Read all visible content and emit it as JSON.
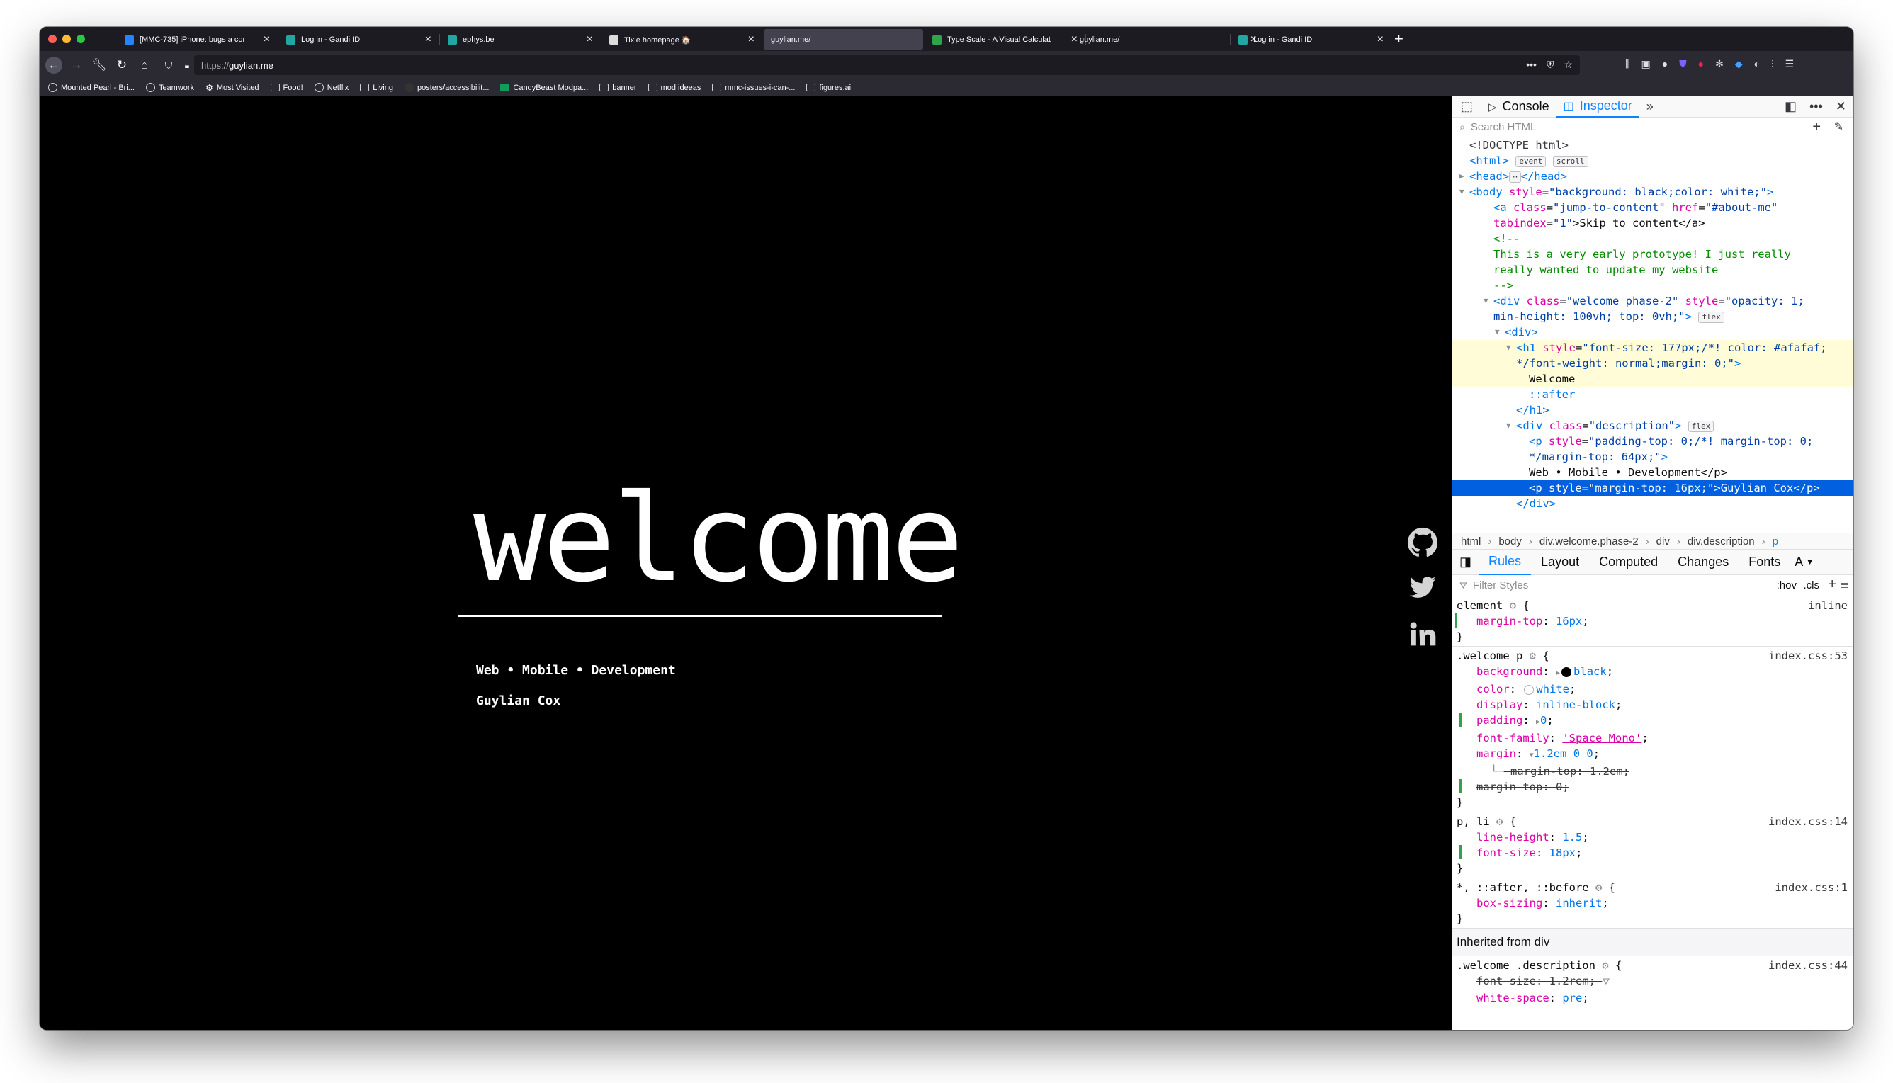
{
  "browser": {
    "tabs": [
      {
        "title": "[MMC-735] iPhone: bugs a cor",
        "active": false
      },
      {
        "title": "Log in - Gandi ID",
        "active": false
      },
      {
        "title": "ephys.be",
        "active": false
      },
      {
        "title": "Tixie homepage 🏠",
        "active": false
      },
      {
        "title": "guylian.me/",
        "active": true
      },
      {
        "title": "Type Scale - A Visual Calculat",
        "active": false
      },
      {
        "title": "guylian.me/",
        "active": false
      },
      {
        "title": "Log in - Gandi ID",
        "active": false
      }
    ],
    "url": {
      "prefix": "https://",
      "host": "guylian.me"
    },
    "bookmarks": [
      "Mounted Pearl - Bri...",
      "Teamwork",
      "Most Visited",
      "Food!",
      "Netflix",
      "Living",
      "posters/accessibilit...",
      "CandyBeast Modpa...",
      "banner",
      "mod ideeas",
      "mmc-issues-i-can-...",
      "figures.ai"
    ]
  },
  "page": {
    "heading": "welcome",
    "tagline": "Web • Mobile • Development",
    "author": "Guylian Cox",
    "social_icons": [
      "github-icon",
      "twitter-icon",
      "linkedin-icon"
    ]
  },
  "devtools": {
    "tabs": {
      "console": "Console",
      "inspector": "Inspector"
    },
    "search_placeholder": "Search HTML",
    "markup": {
      "doctype": "<!DOCTYPE html>",
      "html_open": "<html>",
      "event_badge": "event",
      "scroll_badge": "scroll",
      "head": "<head>",
      "head_close": "</head>",
      "body_tag": "<body",
      "body_attr": "style",
      "body_val": "\"background: black;color: white;\"",
      "a_tag": "<a",
      "a_class_attr": "class",
      "a_class_val": "\"jump-to-content\"",
      "a_href_attr": "href",
      "a_href_val": "\"#about-me\"",
      "a_tabindex_attr": "tabindex",
      "a_tabindex_val": "\"1\"",
      "a_text": ">Skip to content</a>",
      "comment_open": "<!--",
      "comment_line1": "This is a very early prototype! I just really",
      "comment_line2": "really wanted to update my website",
      "comment_close": "-->",
      "div_welcome_tag": "<div",
      "div_welcome_class_attr": "class",
      "div_welcome_class_val": "\"welcome phase-2\"",
      "div_welcome_style_attr": "style",
      "div_welcome_style_val1": "\"opacity: 1;",
      "div_welcome_style_val2": "min-height: 100vh; top: 0vh;\"",
      "flex_badge": "flex",
      "div_open": "<div>",
      "h1_tag": "<h1",
      "h1_style_attr": "style",
      "h1_style_val1": "\"font-size: 177px;/*! color: #afafaf;",
      "h1_style_val2": "*/font-weight: normal;margin: 0;\"",
      "h1_text": "Welcome",
      "after_pseudo": "::after",
      "h1_close": "</h1>",
      "div_desc_tag": "<div",
      "div_desc_class_attr": "class",
      "div_desc_class_val": "\"description\"",
      "p1_tag": "<p",
      "p1_style_attr": "style",
      "p1_style_val1": "\"padding-top: 0;/*! margin-top: 0;",
      "p1_style_val2": "*/margin-top: 64px;\"",
      "p1_text": "Web • Mobile • Development</p>",
      "p2_tag": "<p",
      "p2_style_attr": "style",
      "p2_style_val": "\"margin-top: 16px;\"",
      "p2_text": ">Guylian Cox</p>",
      "div_close": "</div>"
    },
    "breadcrumbs": [
      "html",
      "body",
      "div.welcome.phase-2",
      "div",
      "div.description",
      "p"
    ],
    "rule_tabs": [
      "Rules",
      "Layout",
      "Computed",
      "Changes",
      "Fonts",
      "A"
    ],
    "filter_placeholder": "Filter Styles",
    "filter_actions": {
      "hov": ":hov",
      "cls": ".cls"
    },
    "rules": {
      "element": {
        "selector": "element",
        "source": "inline",
        "props": [
          {
            "name": "margin-top",
            "value": "16px"
          }
        ]
      },
      "welcome_p": {
        "selector": ".welcome p",
        "source": "index.css:53",
        "props": [
          {
            "name": "background",
            "value": "black"
          },
          {
            "name": "color",
            "value": "white"
          },
          {
            "name": "display",
            "value": "inline-block"
          },
          {
            "name": "padding",
            "value": "0"
          },
          {
            "name": "font-family",
            "value": "'Space Mono'"
          },
          {
            "name": "margin",
            "value": "1.2em 0 0"
          },
          {
            "name": "margin-top",
            "value": "1.2em"
          },
          {
            "name": "margin-top",
            "value": "0"
          }
        ]
      },
      "p_li": {
        "selector": "p, li",
        "source": "index.css:14",
        "props": [
          {
            "name": "line-height",
            "value": "1.5"
          },
          {
            "name": "font-size",
            "value": "18px"
          }
        ]
      },
      "universal": {
        "selector": "*, ::after, ::before",
        "source": "index.css:1",
        "props": [
          {
            "name": "box-sizing",
            "value": "inherit"
          }
        ]
      },
      "inherited_label": "Inherited from div",
      "welcome_desc": {
        "selector": ".welcome .description",
        "source": "index.css:44",
        "props": [
          {
            "name": "font-size",
            "value": "1.2rem"
          },
          {
            "name": "white-space",
            "value": "pre"
          }
        ]
      }
    }
  },
  "colors": {
    "page_bg": "#000000",
    "accent": "#0a84ff",
    "selection": "#0060df",
    "highlight": "#fffcd7"
  }
}
